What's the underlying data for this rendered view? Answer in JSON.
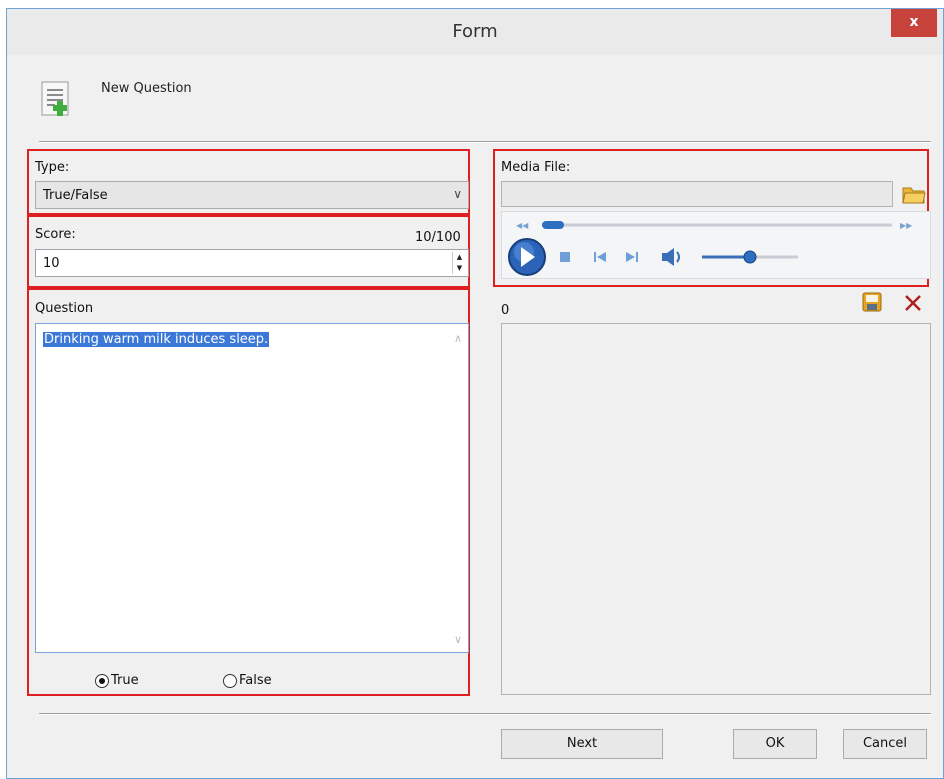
{
  "window": {
    "title": "Form",
    "close_label": "x"
  },
  "header": {
    "title": "New Question",
    "icon": "new-document-add-icon"
  },
  "type_section": {
    "label": "Type:",
    "selected": "True/False",
    "dropdown_icon": "chevron-down-icon"
  },
  "score_section": {
    "label": "Score:",
    "counter": "10/100",
    "value": "10"
  },
  "question_section": {
    "label": "Question",
    "text": "Drinking warm milk induces sleep.",
    "options": [
      {
        "label": "True",
        "selected": true
      },
      {
        "label": "False",
        "selected": false
      }
    ]
  },
  "media_section": {
    "label": "Media File:",
    "path_value": "",
    "browse_icon": "folder-icon",
    "player_icons": [
      "rewind-icon",
      "seek-slider",
      "fast-forward-icon",
      "play-icon",
      "stop-icon",
      "previous-icon",
      "next-icon",
      "volume-icon",
      "volume-slider"
    ]
  },
  "answers_panel": {
    "count": "0",
    "icons": [
      "save-icon",
      "delete-icon"
    ]
  },
  "buttons": {
    "next": "Next",
    "ok": "OK",
    "cancel": "Cancel"
  },
  "colors": {
    "highlight_border": "#e02020",
    "selection": "#3b78d8",
    "close_button": "#c7433c"
  }
}
